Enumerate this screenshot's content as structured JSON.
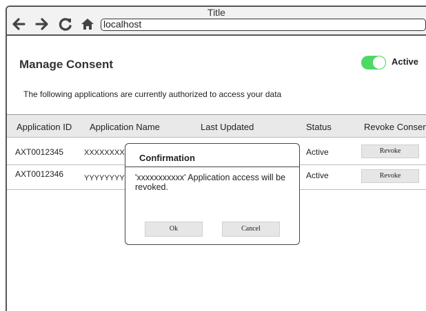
{
  "window": {
    "title": "Title"
  },
  "browser": {
    "back_icon": "back-arrow-icon",
    "forward_icon": "forward-arrow-icon",
    "reload_icon": "reload-icon",
    "home_icon": "home-icon",
    "address": "localhost"
  },
  "page": {
    "title": "Manage Consent",
    "toggle_label": "Active",
    "toggle_on": true,
    "description": "The following applications are currently authorized to access your data"
  },
  "table": {
    "headers": [
      "Application ID",
      "Application Name",
      "Last Updated",
      "Status",
      "Revoke Consent"
    ],
    "rows": [
      {
        "id": "AXT0012345",
        "name": "XXXXXXXXX",
        "status": "Active",
        "action": "Revoke"
      },
      {
        "id": "AXT0012346",
        "name": "YYYYYYYYY",
        "status": "Active",
        "action": "Revoke"
      }
    ]
  },
  "modal": {
    "title": "Confirmation",
    "message": "'xxxxxxxxxxx'  Application access will be revoked.",
    "ok_label": "Ok",
    "cancel_label": "Cancel"
  },
  "colors": {
    "toggle": "#4cd964",
    "header_bg": "#e9e9e9",
    "button_bg": "#e6e6e6"
  }
}
